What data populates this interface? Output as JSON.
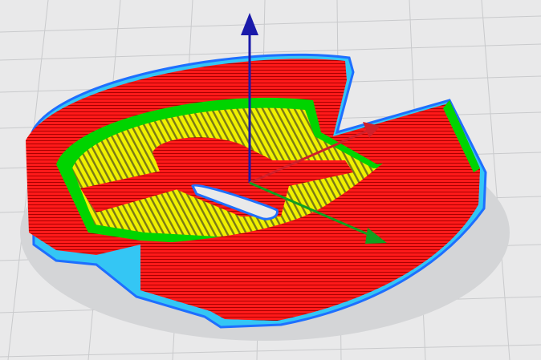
{
  "viewport": {
    "view": "layer-view-3d",
    "colors": {
      "background": "#e9e9ea",
      "grid_line": "#c9cacc",
      "shadow": "#d0d1d3",
      "outer_wall": "#ff1a1a",
      "inner_wall": "#00d400",
      "infill": "#f0f000",
      "skirt": "#1e90ff",
      "skirt_inner": "#34c6f4",
      "axis_x": "#d0202a",
      "axis_y": "#10a020",
      "axis_z": "#1a1aaa"
    },
    "axes": [
      {
        "name": "x",
        "icon": "x-axis-arrow-icon"
      },
      {
        "name": "y",
        "icon": "y-axis-arrow-icon"
      },
      {
        "name": "z",
        "icon": "z-axis-arrow-icon"
      }
    ],
    "model": {
      "icon": "sliced-model-toolpath"
    }
  }
}
